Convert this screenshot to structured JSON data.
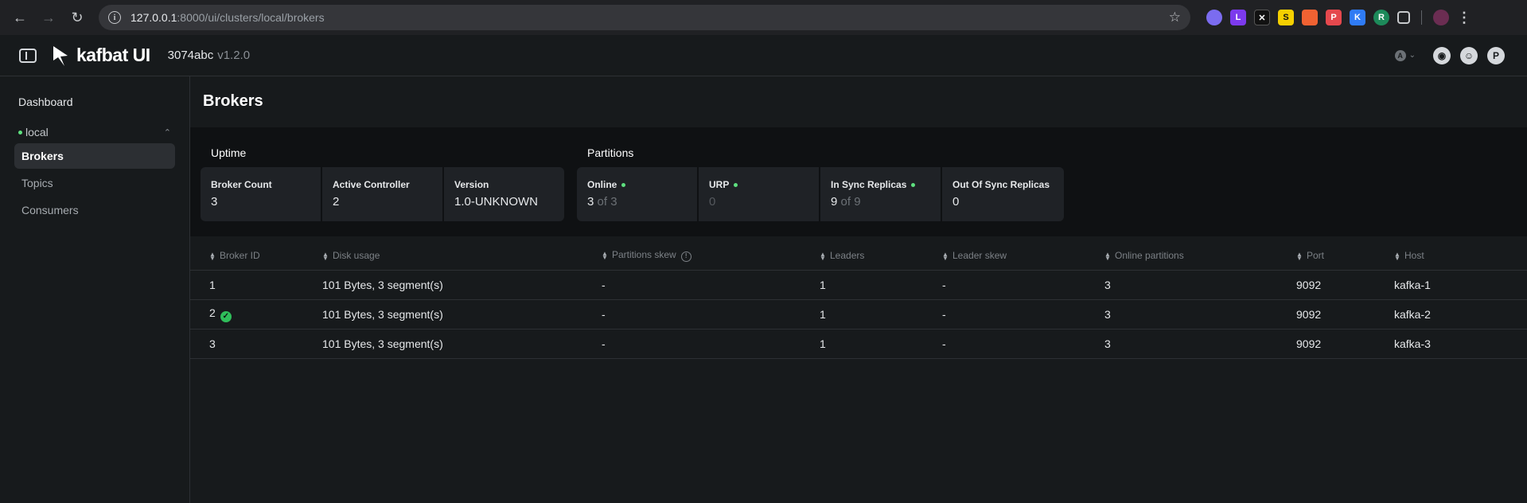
{
  "browser": {
    "url_host": "127.0.0.1",
    "url_path": ":8000/ui/clusters/local/brokers"
  },
  "header": {
    "logo_text": "kafbat UI",
    "commit": "3074abc",
    "version": "v1.2.0"
  },
  "sidebar": {
    "dashboard": "Dashboard",
    "cluster": "local",
    "items": [
      {
        "label": "Brokers"
      },
      {
        "label": "Topics"
      },
      {
        "label": "Consumers"
      }
    ]
  },
  "page": {
    "title": "Brokers"
  },
  "uptime": {
    "title": "Uptime",
    "broker_count_label": "Broker Count",
    "broker_count": "3",
    "active_controller_label": "Active Controller",
    "active_controller": "2",
    "version_label": "Version",
    "version": "1.0-UNKNOWN"
  },
  "partitions": {
    "title": "Partitions",
    "online_label": "Online",
    "online_value": "3",
    "online_total": "of 3",
    "urp_label": "URP",
    "urp_value": "0",
    "isr_label": "In Sync Replicas",
    "isr_value": "9",
    "isr_total": "of 9",
    "oosr_label": "Out Of Sync Replicas",
    "oosr_value": "0"
  },
  "table": {
    "headers": [
      "Broker ID",
      "Disk usage",
      "Partitions skew",
      "Leaders",
      "Leader skew",
      "Online partitions",
      "Port",
      "Host"
    ],
    "rows": [
      {
        "id": "1",
        "disk": "101 Bytes, 3 segment(s)",
        "skew": "-",
        "leaders": "1",
        "leader_skew": "-",
        "online": "3",
        "port": "9092",
        "host": "kafka-1"
      },
      {
        "id": "2",
        "disk": "101 Bytes, 3 segment(s)",
        "skew": "-",
        "leaders": "1",
        "leader_skew": "-",
        "online": "3",
        "port": "9092",
        "host": "kafka-2"
      },
      {
        "id": "3",
        "disk": "101 Bytes, 3 segment(s)",
        "skew": "-",
        "leaders": "1",
        "leader_skew": "-",
        "online": "3",
        "port": "9092",
        "host": "kafka-3"
      }
    ]
  }
}
